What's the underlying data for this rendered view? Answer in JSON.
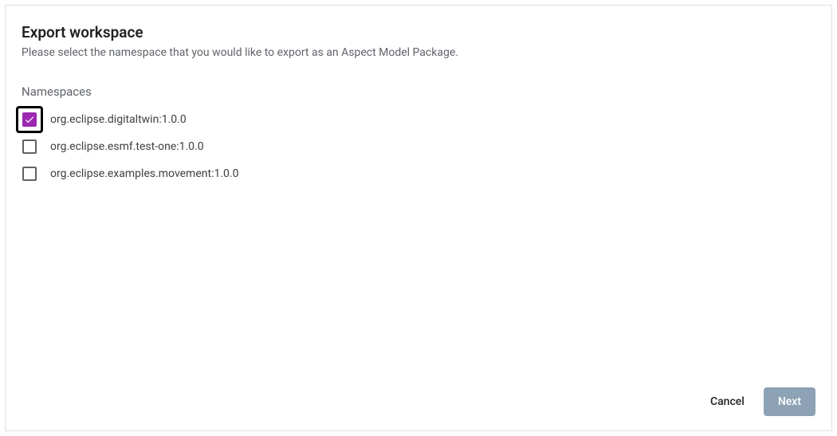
{
  "dialog": {
    "title": "Export workspace",
    "subtitle": "Please select the namespace that you would like to export as an Aspect Model Package.",
    "section_label": "Namespaces",
    "items": [
      {
        "label": "org.eclipse.digitaltwin:1.0.0",
        "checked": true,
        "highlighted": true
      },
      {
        "label": "org.eclipse.esmf.test-one:1.0.0",
        "checked": false,
        "highlighted": false
      },
      {
        "label": "org.eclipse.examples.movement:1.0.0",
        "checked": false,
        "highlighted": false
      }
    ],
    "actions": {
      "cancel": "Cancel",
      "next": "Next"
    }
  }
}
